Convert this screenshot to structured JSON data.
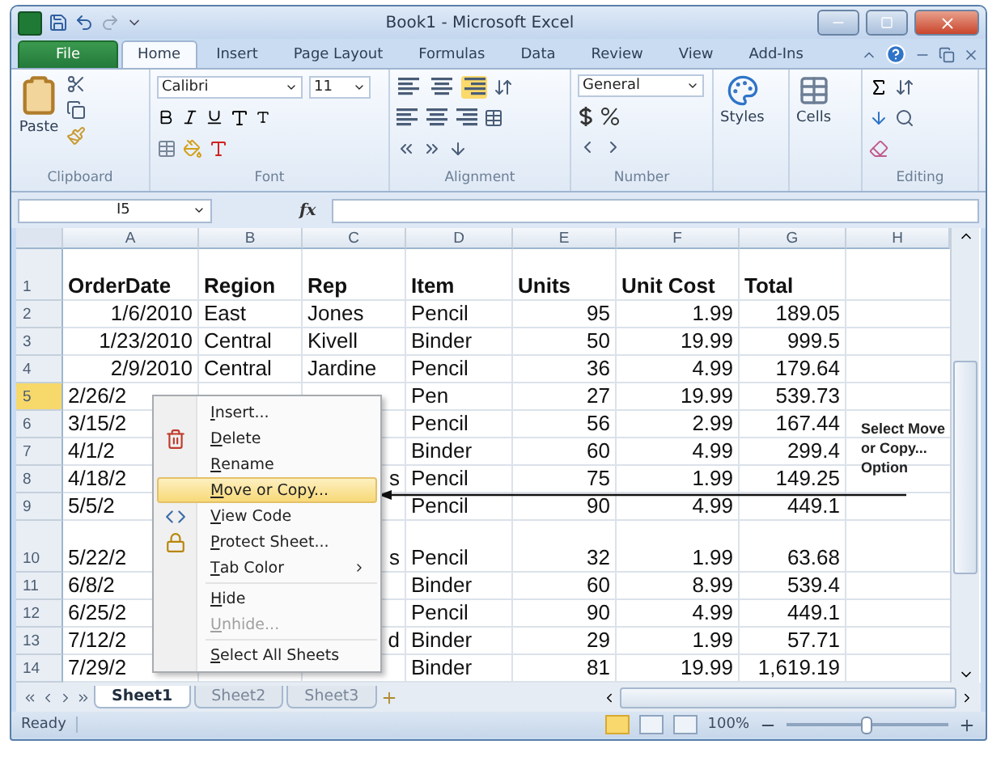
{
  "window": {
    "title": "Book1 - Microsoft Excel"
  },
  "tabs": [
    {
      "label": "File",
      "kind": "file",
      "selected": false
    },
    {
      "label": "Home",
      "kind": "tab",
      "selected": true
    },
    {
      "label": "Insert",
      "kind": "tab",
      "selected": false
    },
    {
      "label": "Page Layout",
      "kind": "tab",
      "selected": false
    },
    {
      "label": "Formulas",
      "kind": "tab",
      "selected": false
    },
    {
      "label": "Data",
      "kind": "tab",
      "selected": false
    },
    {
      "label": "Review",
      "kind": "tab",
      "selected": false
    },
    {
      "label": "View",
      "kind": "tab",
      "selected": false
    },
    {
      "label": "Add-Ins",
      "kind": "tab",
      "selected": false
    }
  ],
  "ribbon": {
    "clipboard": {
      "label": "Clipboard",
      "paste": "Paste"
    },
    "font": {
      "label": "Font",
      "name": "Calibri",
      "size": "11"
    },
    "alignment": {
      "label": "Alignment"
    },
    "number": {
      "label": "Number",
      "format": "General"
    },
    "styles": {
      "button": "Styles"
    },
    "cells": {
      "button": "Cells"
    },
    "editing": {
      "label": "Editing"
    }
  },
  "formula_bar": {
    "name_box": "I5",
    "fx": "fx"
  },
  "columns": [
    "A",
    "B",
    "C",
    "D",
    "E",
    "F",
    "G",
    "H"
  ],
  "rows": [
    {
      "header": "1",
      "kind": "header",
      "tall": true,
      "covered": false,
      "selected": false,
      "cells": {
        "A": "OrderDate",
        "B": "Region",
        "C": "Rep",
        "D": "Item",
        "E": "Units",
        "F": "Unit Cost",
        "G": "Total"
      }
    },
    {
      "header": "2",
      "kind": "data",
      "tall": false,
      "covered": false,
      "selected": false,
      "cells": {
        "A": "1/6/2010",
        "B": "East",
        "C": "Jones",
        "D": "Pencil",
        "E": "95",
        "F": "1.99",
        "G": "189.05"
      }
    },
    {
      "header": "3",
      "kind": "data",
      "tall": false,
      "covered": false,
      "selected": false,
      "cells": {
        "A": "1/23/2010",
        "B": "Central",
        "C": "Kivell",
        "D": "Binder",
        "E": "50",
        "F": "19.99",
        "G": "999.5"
      }
    },
    {
      "header": "4",
      "kind": "data",
      "tall": false,
      "covered": false,
      "selected": false,
      "cells": {
        "A": "2/9/2010",
        "B": "Central",
        "C": "Jardine",
        "D": "Pencil",
        "E": "36",
        "F": "4.99",
        "G": "179.64"
      }
    },
    {
      "header": "5",
      "kind": "data",
      "tall": false,
      "covered": true,
      "selected": true,
      "cells": {
        "A": "2/26/2",
        "D": "Pen",
        "E": "27",
        "F": "19.99",
        "G": "539.73"
      }
    },
    {
      "header": "6",
      "kind": "data",
      "tall": false,
      "covered": true,
      "selected": false,
      "cells": {
        "A": "3/15/2",
        "D": "Pencil",
        "E": "56",
        "F": "2.99",
        "G": "167.44"
      }
    },
    {
      "header": "7",
      "kind": "data",
      "tall": false,
      "covered": true,
      "selected": false,
      "cells": {
        "A": "4/1/2",
        "D": "Binder",
        "E": "60",
        "F": "4.99",
        "G": "299.4"
      }
    },
    {
      "header": "8",
      "kind": "data",
      "tall": false,
      "covered": true,
      "selected": false,
      "cells": {
        "A": "4/18/2",
        "C": "s",
        "D": "Pencil",
        "E": "75",
        "F": "1.99",
        "G": "149.25"
      }
    },
    {
      "header": "9",
      "kind": "data",
      "tall": false,
      "covered": true,
      "selected": false,
      "cells": {
        "A": "5/5/2",
        "D": "Pencil",
        "E": "90",
        "F": "4.99",
        "G": "449.1"
      }
    },
    {
      "header": "10",
      "kind": "data",
      "tall": true,
      "covered": true,
      "selected": false,
      "cells": {
        "A": "5/22/2",
        "C": "s",
        "D": "Pencil",
        "E": "32",
        "F": "1.99",
        "G": "63.68"
      }
    },
    {
      "header": "11",
      "kind": "data",
      "tall": false,
      "covered": true,
      "selected": false,
      "cells": {
        "A": "6/8/2",
        "D": "Binder",
        "E": "60",
        "F": "8.99",
        "G": "539.4"
      }
    },
    {
      "header": "12",
      "kind": "data",
      "tall": false,
      "covered": true,
      "selected": false,
      "cells": {
        "A": "6/25/2",
        "D": "Pencil",
        "E": "90",
        "F": "4.99",
        "G": "449.1"
      }
    },
    {
      "header": "13",
      "kind": "data",
      "tall": false,
      "covered": true,
      "selected": false,
      "cells": {
        "A": "7/12/2",
        "C": "d",
        "D": "Binder",
        "E": "29",
        "F": "1.99",
        "G": "57.71"
      }
    },
    {
      "header": "14",
      "kind": "data",
      "tall": false,
      "covered": true,
      "selected": false,
      "cells": {
        "A": "7/29/2",
        "D": "Binder",
        "E": "81",
        "F": "19.99",
        "G": "1,619.19"
      }
    }
  ],
  "context_menu": {
    "items": [
      {
        "label": "Insert...",
        "kind": "item",
        "disabled": false,
        "selected": false
      },
      {
        "label": "Delete",
        "kind": "item",
        "disabled": false,
        "selected": false
      },
      {
        "label": "Rename",
        "kind": "item",
        "disabled": false,
        "selected": false
      },
      {
        "label": "Move or Copy...",
        "kind": "item",
        "disabled": false,
        "selected": true
      },
      {
        "label": "View Code",
        "kind": "item",
        "disabled": false,
        "selected": false
      },
      {
        "label": "Protect Sheet...",
        "kind": "item",
        "disabled": false,
        "selected": false
      },
      {
        "label": "Tab Color",
        "kind": "submenu",
        "disabled": false,
        "selected": false
      },
      {
        "kind": "separator"
      },
      {
        "label": "Hide",
        "kind": "item",
        "disabled": false,
        "selected": false
      },
      {
        "label": "Unhide...",
        "kind": "item",
        "disabled": true,
        "selected": false
      },
      {
        "kind": "separator"
      },
      {
        "label": "Select All Sheets",
        "kind": "item",
        "disabled": false,
        "selected": false
      }
    ]
  },
  "annotation": {
    "note": "Select Move or Copy... Option"
  },
  "sheet_tabs": [
    {
      "label": "Sheet1",
      "selected": true
    },
    {
      "label": "Sheet2",
      "selected": false
    },
    {
      "label": "Sheet3",
      "selected": false
    }
  ],
  "status_bar": {
    "text": "Ready",
    "views": [
      {
        "selected": true
      },
      {
        "selected": false
      },
      {
        "selected": false
      }
    ],
    "zoom": "100%",
    "zoom_slider": {
      "level": 0.5
    }
  }
}
